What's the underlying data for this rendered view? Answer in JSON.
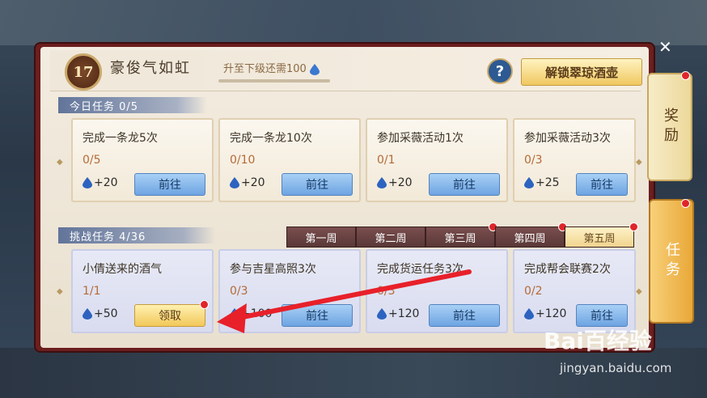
{
  "header": {
    "level": "17",
    "player_title": "豪俊气如虹",
    "upgrade_text": "升至下级还需100",
    "help_label": "?",
    "unlock_label": "解锁翠琼酒壶"
  },
  "daily": {
    "section_label": "今日任务  0/5",
    "cards": [
      {
        "title": "完成一条龙5次",
        "progress": "0/5",
        "reward": "+20",
        "button": "前往"
      },
      {
        "title": "完成一条龙10次",
        "progress": "0/10",
        "reward": "+20",
        "button": "前往"
      },
      {
        "title": "参加采薇活动1次",
        "progress": "0/1",
        "reward": "+20",
        "button": "前往"
      },
      {
        "title": "参加采薇活动3次",
        "progress": "0/3",
        "reward": "+25",
        "button": "前往"
      }
    ]
  },
  "challenge": {
    "section_label": "挑战任务  4/36",
    "weeks": [
      "第一周",
      "第二周",
      "第三周",
      "第四周",
      "第五周"
    ],
    "active_week": 4,
    "cards": [
      {
        "title": "小倩送来的酒气",
        "progress": "1/1",
        "reward": "+50",
        "button": "领取"
      },
      {
        "title": "参与吉星高照3次",
        "progress": "0/3",
        "reward": "+100",
        "button": "前往"
      },
      {
        "title": "完成货运任务3次",
        "progress": "0/3",
        "reward": "+120",
        "button": "前往"
      },
      {
        "title": "完成帮会联赛2次",
        "progress": "0/2",
        "reward": "+120",
        "button": "前往"
      }
    ]
  },
  "side": {
    "reward_tab": "奖励",
    "task_tab": "任务"
  },
  "watermark": {
    "brand": "Bai百经验",
    "url": "jingyan.baidu.com"
  },
  "colors": {
    "accent_red": "#e0252a",
    "annotation_arrow": "#e8202a"
  }
}
